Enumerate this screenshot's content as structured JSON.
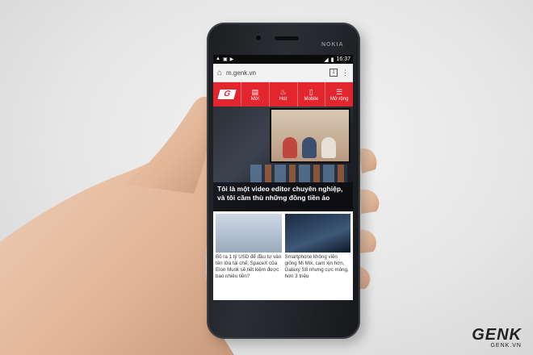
{
  "scene": {
    "description_colors": {
      "background": "#e8e8e8",
      "skin": "#e7c3a9",
      "phone_body": "#1e2024",
      "accent": "#e3262d"
    }
  },
  "phone": {
    "brand": "NOKIA"
  },
  "status_bar": {
    "time": "16:37"
  },
  "browser": {
    "url": "m.genk.vn",
    "tab_count": "1"
  },
  "site_nav": {
    "logo": "G",
    "items": [
      {
        "label": "Mới",
        "icon": "document-icon"
      },
      {
        "label": "Hot",
        "icon": "flame-icon"
      },
      {
        "label": "Mobile",
        "icon": "phone-icon"
      },
      {
        "label": "Mở rộng",
        "icon": "menu-icon"
      }
    ]
  },
  "hero": {
    "headline": "Tôi là một video editor chuyên nghiệp, và tôi cầm thù những đồng tiền ảo"
  },
  "cards": [
    {
      "text": "Bỏ ra 1 tỷ USD để đầu tư vào tên lửa tái chế, SpaceX của Elon Musk sẽ tiết kiệm được bao nhiêu tiền?"
    },
    {
      "text": "Smartphone không viền giống Mi Mix, cam xịn hơn, Galaxy S8 nhưng cực mỏng, hơn 3 triệu"
    }
  ],
  "watermark": {
    "brand": "GENK",
    "site": "GENK.VN"
  }
}
